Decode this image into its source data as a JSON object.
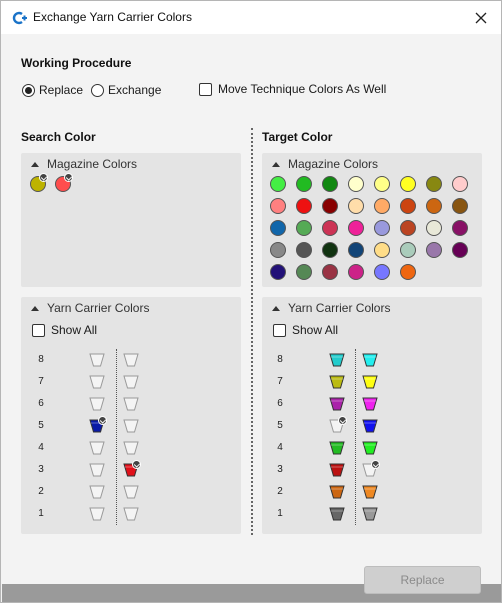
{
  "window": {
    "title": "Exchange Yarn Carrier Colors",
    "close_icon": "close-icon",
    "app_icon": "app-logo-icon"
  },
  "procedure": {
    "title": "Working Procedure",
    "options": [
      {
        "label": "Replace",
        "checked": true
      },
      {
        "label": "Exchange",
        "checked": false
      }
    ],
    "move_technique": {
      "label": "Move Technique Colors As Well",
      "checked": false
    }
  },
  "search": {
    "title": "Search Color",
    "magazine_header": "Magazine Colors",
    "magazine_colors": [
      {
        "color": "#bdb300",
        "selected": true
      },
      {
        "color": "#ff4d4d",
        "selected": true
      }
    ],
    "carrier_header": "Yarn Carrier Colors",
    "show_all": {
      "label": "Show All",
      "checked": false
    },
    "rows": [
      {
        "num": "8",
        "left": "",
        "left_sel": false,
        "right": "",
        "right_sel": false
      },
      {
        "num": "7",
        "left": "",
        "left_sel": false,
        "right": "",
        "right_sel": false
      },
      {
        "num": "6",
        "left": "",
        "left_sel": false,
        "right": "",
        "right_sel": false
      },
      {
        "num": "5",
        "left": "#0a1aa6",
        "left_sel": true,
        "right": "",
        "right_sel": false
      },
      {
        "num": "4",
        "left": "",
        "left_sel": false,
        "right": "",
        "right_sel": false
      },
      {
        "num": "3",
        "left": "",
        "left_sel": false,
        "right": "#e0101a",
        "right_sel": true
      },
      {
        "num": "2",
        "left": "",
        "left_sel": false,
        "right": "",
        "right_sel": false
      },
      {
        "num": "1",
        "left": "",
        "left_sel": false,
        "right": "",
        "right_sel": false
      }
    ]
  },
  "target": {
    "title": "Target Color",
    "magazine_header": "Magazine Colors",
    "magazine_colors": [
      [
        "#44ee44",
        "#22bb22",
        "#118811",
        "#ffffcc",
        "#ffff88",
        "#ffff22",
        "#888811",
        "#ffcccc"
      ],
      [
        "#ff8080",
        "#ee1111",
        "#880000",
        "#ffddaa",
        "#ffaa66",
        "#cc4411",
        "#cc6611",
        "#885511"
      ],
      [
        "#1166aa",
        "#55aa55",
        "#cc3355",
        "#ee2299",
        "#9999dd",
        "#bb4422",
        "#e8e8d8",
        "#881166"
      ],
      [
        "#888888",
        "#555555",
        "#113311",
        "#114477",
        "#ffdd88",
        "#aaccbb",
        "#9977aa",
        "#660055"
      ],
      [
        "#221177",
        "#558855",
        "#993344",
        "#cc2288",
        "#7777ff",
        "#ee6611"
      ]
    ],
    "carrier_header": "Yarn Carrier Colors",
    "show_all": {
      "label": "Show All",
      "checked": false
    },
    "rows": [
      {
        "num": "8",
        "left": "#22cccc",
        "left_sel": false,
        "right": "#22eeee",
        "right_sel": false
      },
      {
        "num": "7",
        "left": "#bbbb11",
        "left_sel": false,
        "right": "#ffff11",
        "right_sel": false
      },
      {
        "num": "6",
        "left": "#aa22aa",
        "left_sel": false,
        "right": "#ee22ee",
        "right_sel": false
      },
      {
        "num": "5",
        "left": "",
        "left_sel": true,
        "right": "#1111ee",
        "right_sel": false
      },
      {
        "num": "4",
        "left": "#22bb22",
        "left_sel": false,
        "right": "#22ee22",
        "right_sel": false
      },
      {
        "num": "3",
        "left": "#bb1111",
        "left_sel": false,
        "right": "",
        "right_sel": true
      },
      {
        "num": "2",
        "left": "#cc6611",
        "left_sel": false,
        "right": "#ee8822",
        "right_sel": false
      },
      {
        "num": "1",
        "left": "#666666",
        "left_sel": false,
        "right": "#999999",
        "right_sel": false
      }
    ]
  },
  "actions": {
    "replace_label": "Replace",
    "replace_enabled": false
  }
}
